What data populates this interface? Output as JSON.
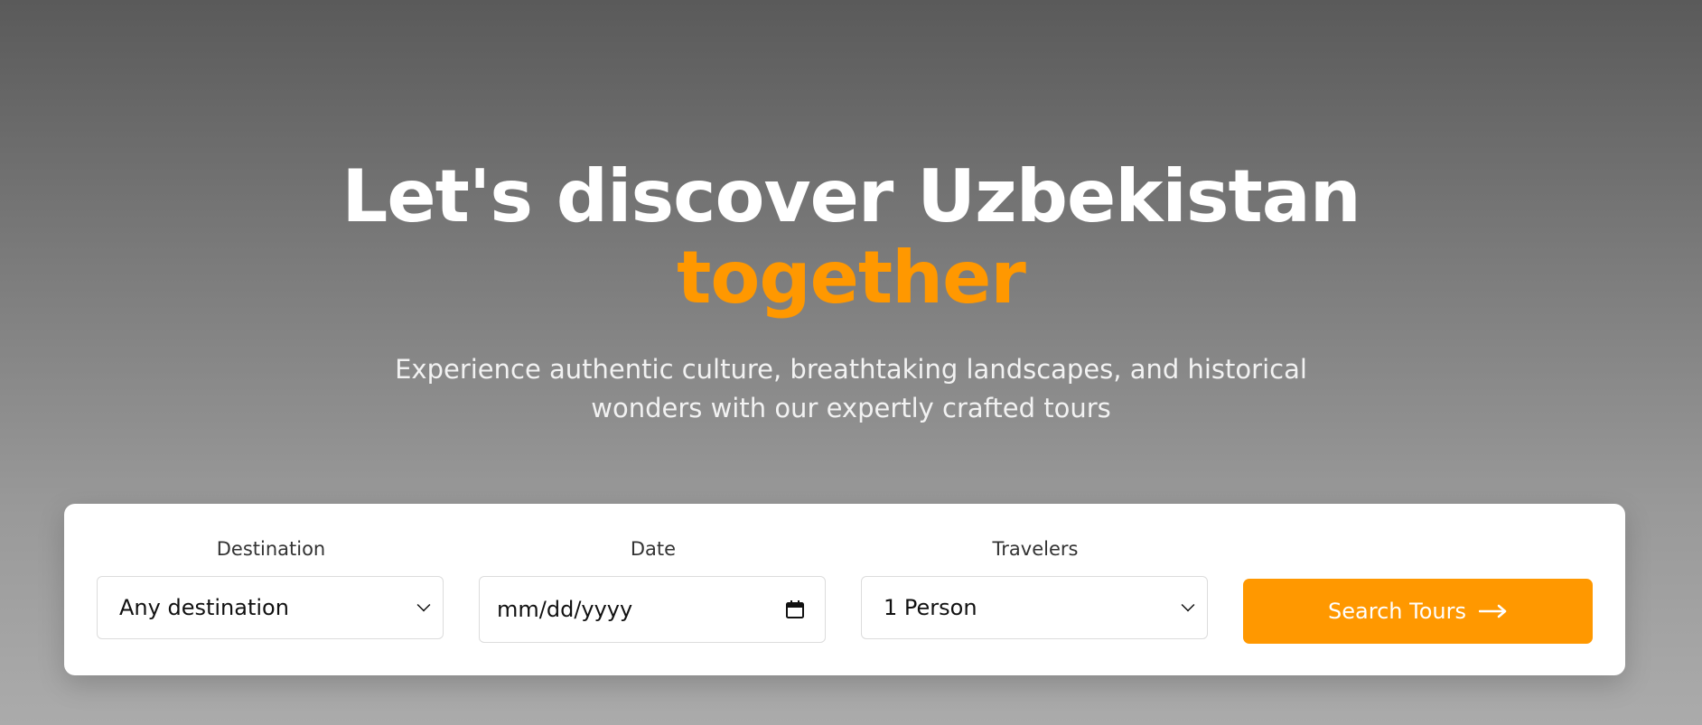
{
  "hero": {
    "title_line1": "Let's discover Uzbekistan",
    "title_line2": "together",
    "subtitle_line1": "Experience authentic culture, breathtaking landscapes, and historical",
    "subtitle_line2": "wonders with our expertly crafted tours"
  },
  "search": {
    "destination": {
      "label": "Destination",
      "selected": "Any destination"
    },
    "date": {
      "label": "Date",
      "placeholder": "mm/dd/yyyy"
    },
    "travelers": {
      "label": "Travelers",
      "selected": "1 Person"
    },
    "button_label": "Search Tours",
    "button_icon": "arrow-right-icon"
  },
  "colors": {
    "accent": "#ff9800",
    "title": "#ffffff",
    "panel": "#ffffff"
  }
}
